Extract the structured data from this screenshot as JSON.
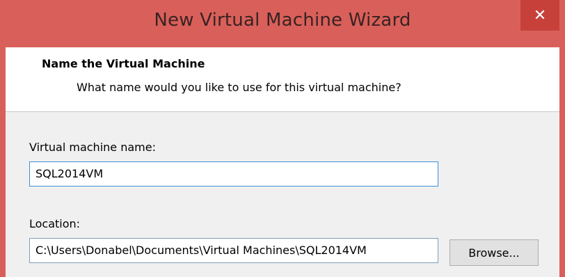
{
  "window": {
    "title": "New Virtual Machine Wizard",
    "close_glyph": "✕"
  },
  "header": {
    "title": "Name the Virtual Machine",
    "subtitle": "What name would you like to use for this virtual machine?"
  },
  "form": {
    "name_label": "Virtual machine name:",
    "name_value": "SQL2014VM",
    "location_label": "Location:",
    "location_value": "C:\\Users\\Donabel\\Documents\\Virtual Machines\\SQL2014VM",
    "browse_label": "Browse..."
  }
}
